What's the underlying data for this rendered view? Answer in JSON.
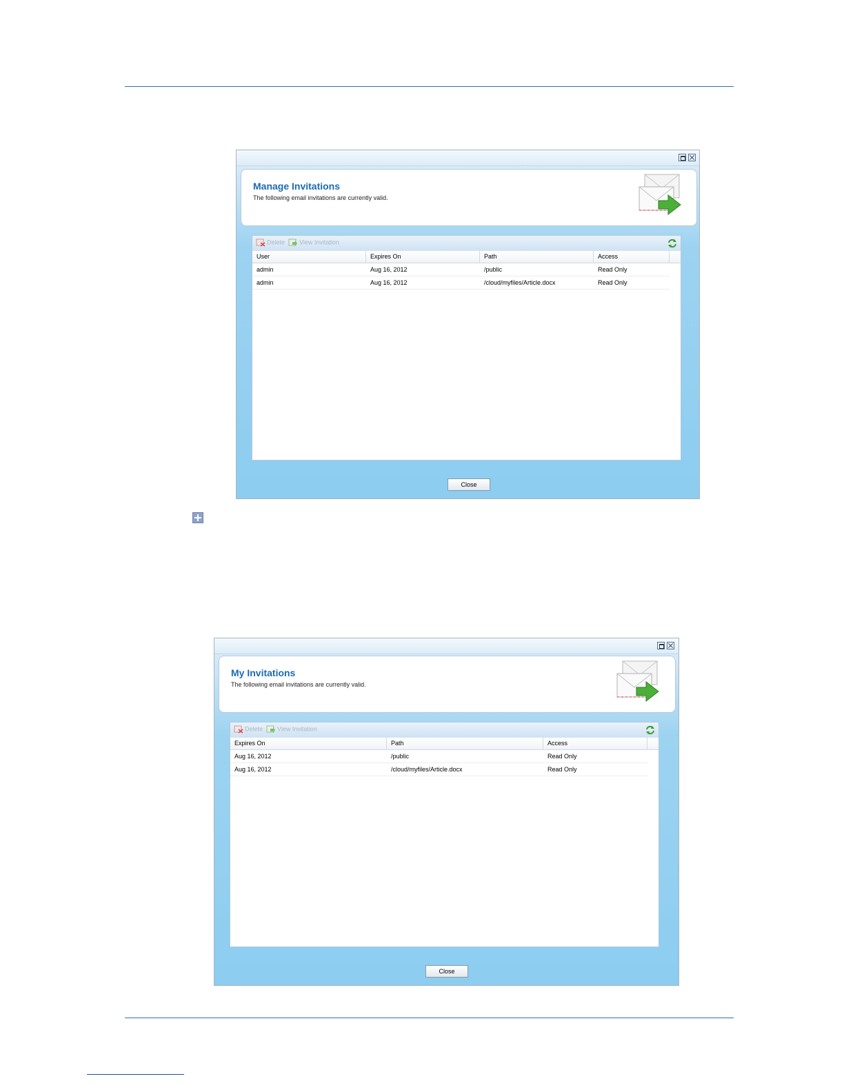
{
  "dialogs": {
    "manage": {
      "title": "Manage Invitations",
      "subtitle": "The following email invitations are currently valid.",
      "toolbar": {
        "delete": "Delete",
        "view": "View Invitation"
      },
      "columns": [
        "User",
        "Expires On",
        "Path",
        "Access"
      ],
      "rows": [
        [
          "admin",
          "Aug 16, 2012",
          "/public",
          "Read Only"
        ],
        [
          "admin",
          "Aug 16, 2012",
          "/cloud/myfiles/Article.docx",
          "Read Only"
        ]
      ],
      "close": "Close"
    },
    "mine": {
      "title": "My Invitations",
      "subtitle": "The following email invitations are currently valid.",
      "toolbar": {
        "delete": "Delete",
        "view": "View Invitation"
      },
      "columns": [
        "Expires On",
        "Path",
        "Access"
      ],
      "rows": [
        [
          "Aug 16, 2012",
          "/public",
          "Read Only"
        ],
        [
          "Aug 16, 2012",
          "/cloud/myfiles/Article.docx",
          "Read Only"
        ]
      ],
      "close": "Close"
    }
  },
  "icons": {
    "window_maximize": "window-maximize-icon",
    "window_close": "window-close-icon",
    "mail": "mail-send-icon",
    "delete": "delete-icon",
    "view": "view-invitation-icon",
    "refresh": "refresh-icon",
    "expand": "expand-plus-icon"
  },
  "colors": {
    "accent": "#1c6bb2",
    "rule": "#2f6fb5"
  }
}
